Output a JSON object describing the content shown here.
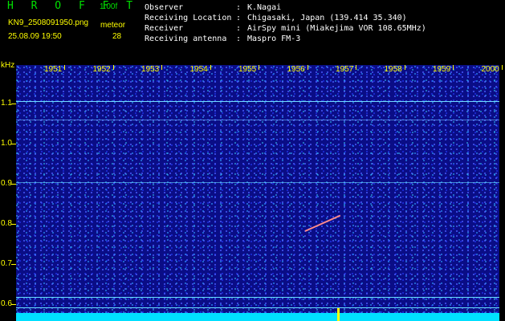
{
  "header": {
    "app_title": "H R O F F T",
    "version": "1.00f",
    "filename": "KN9_2508091950.png",
    "datetime": "25.08.09 19:50",
    "meteor_label": "meteor",
    "meteor_count": "28"
  },
  "info": [
    {
      "key": "Observer",
      "sep": ":",
      "value": "K.Nagai"
    },
    {
      "key": "Receiving Location",
      "sep": ":",
      "value": "Chigasaki, Japan (139.414 35.340)"
    },
    {
      "key": "Receiver",
      "sep": ":",
      "value": "AirSpy mini (Miakejima VOR 108.65MHz)"
    },
    {
      "key": "Receiving antenna",
      "sep": ":",
      "value": "Maspro FM-3"
    }
  ],
  "plot": {
    "y_unit": "kHz",
    "y_ticks": [
      "1.1",
      "1.0",
      "0.9",
      "0.8",
      "0.7",
      "0.6"
    ],
    "x_ticks": [
      "1951",
      "1952",
      "1953",
      "1954",
      "1955",
      "1956",
      "1957",
      "1958",
      "1959",
      "2000"
    ],
    "colors": {
      "background": "#0a0d86",
      "tick": "#ffff00",
      "baseline": "#00e0ff",
      "meteor": "#ff8a8a",
      "signal_line": "#66e0ff"
    }
  }
}
